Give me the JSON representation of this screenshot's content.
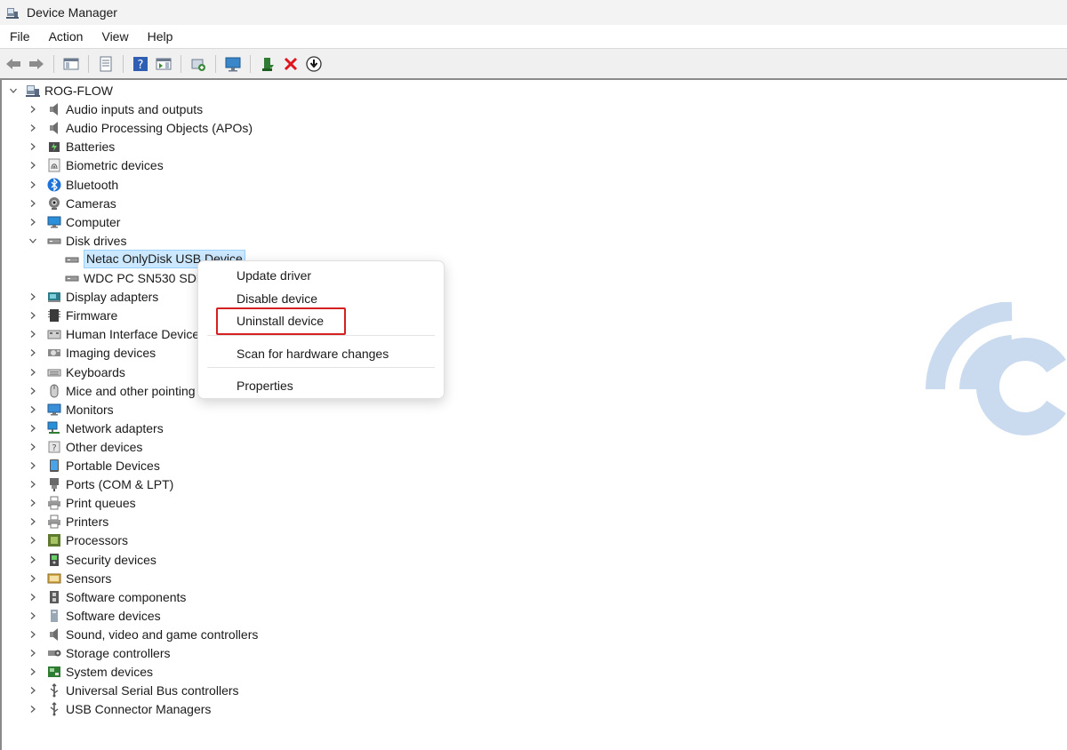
{
  "window": {
    "title": "Device Manager"
  },
  "menubar": {
    "items": [
      "File",
      "Action",
      "View",
      "Help"
    ]
  },
  "toolbar": {
    "buttons": [
      "back-icon",
      "forward-icon",
      "show-hide-console-tree-icon",
      "properties-icon",
      "help-icon",
      "action-pane-icon",
      "scan-hardware-icon",
      "monitor-icon",
      "enable-device-icon",
      "uninstall-device-icon",
      "update-driver-icon"
    ]
  },
  "tree": {
    "root": "ROG-FLOW",
    "categories": [
      {
        "label": "Audio inputs and outputs",
        "icon": "speaker-icon"
      },
      {
        "label": "Audio Processing Objects (APOs)",
        "icon": "speaker-icon"
      },
      {
        "label": "Batteries",
        "icon": "battery-icon"
      },
      {
        "label": "Biometric devices",
        "icon": "fingerprint-icon"
      },
      {
        "label": "Bluetooth",
        "icon": "bluetooth-icon"
      },
      {
        "label": "Cameras",
        "icon": "camera-icon"
      },
      {
        "label": "Computer",
        "icon": "computer-icon"
      },
      {
        "label": "Disk drives",
        "icon": "disk-drive-icon",
        "expanded": true
      },
      {
        "label": "Display adapters",
        "icon": "display-adapter-icon"
      },
      {
        "label": "Firmware",
        "icon": "firmware-icon"
      },
      {
        "label": "Human Interface Devices",
        "icon": "hid-icon"
      },
      {
        "label": "Imaging devices",
        "icon": "imaging-icon"
      },
      {
        "label": "Keyboards",
        "icon": "keyboard-icon"
      },
      {
        "label": "Mice and other pointing",
        "icon": "mouse-icon"
      },
      {
        "label": "Monitors",
        "icon": "monitor-icon"
      },
      {
        "label": "Network adapters",
        "icon": "network-icon"
      },
      {
        "label": "Other devices",
        "icon": "other-device-icon"
      },
      {
        "label": "Portable Devices",
        "icon": "portable-device-icon"
      },
      {
        "label": "Ports (COM & LPT)",
        "icon": "port-icon"
      },
      {
        "label": "Print queues",
        "icon": "printer-icon"
      },
      {
        "label": "Printers",
        "icon": "printer-icon"
      },
      {
        "label": "Processors",
        "icon": "processor-icon"
      },
      {
        "label": "Security devices",
        "icon": "security-icon"
      },
      {
        "label": "Sensors",
        "icon": "sensor-icon"
      },
      {
        "label": "Software components",
        "icon": "software-component-icon"
      },
      {
        "label": "Software devices",
        "icon": "software-device-icon"
      },
      {
        "label": "Sound, video and game controllers",
        "icon": "speaker-icon"
      },
      {
        "label": "Storage controllers",
        "icon": "storage-controller-icon"
      },
      {
        "label": "System devices",
        "icon": "system-device-icon"
      },
      {
        "label": "Universal Serial Bus controllers",
        "icon": "usb-icon"
      },
      {
        "label": "USB Connector Managers",
        "icon": "usb-icon"
      }
    ],
    "disk_children": [
      {
        "label": "Netac OnlyDisk USB Device",
        "selected": true
      },
      {
        "label": "WDC PC SN530 SDBP"
      }
    ]
  },
  "context_menu": {
    "items": [
      "Update driver",
      "Disable device",
      "Uninstall device",
      "Scan for hardware changes",
      "Properties"
    ],
    "highlighted": "Uninstall device"
  },
  "colors": {
    "selection_bg": "#cce8ff",
    "highlight_border": "#d42020",
    "watermark": "#c5d6ee"
  }
}
